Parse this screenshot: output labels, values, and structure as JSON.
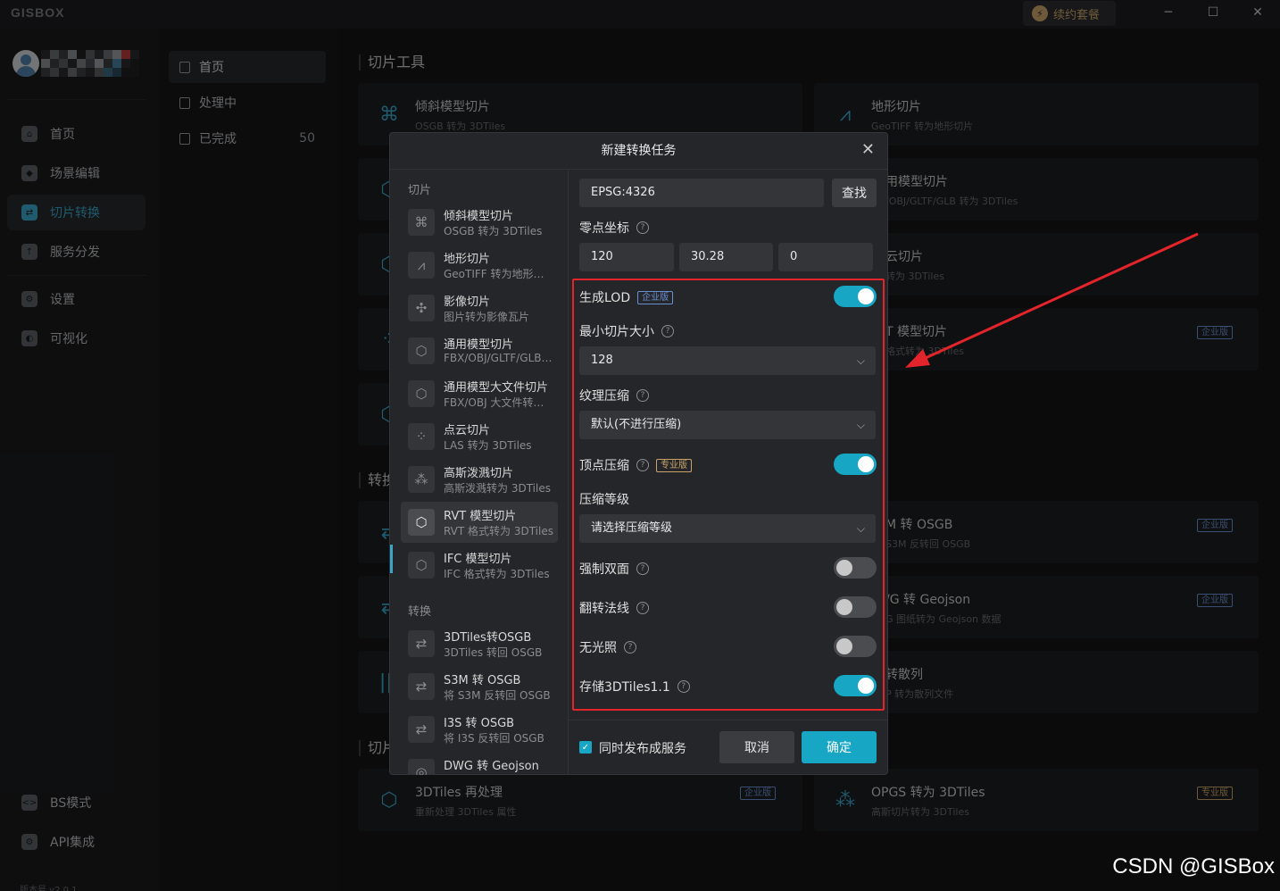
{
  "app": {
    "logo": "GISBOX",
    "renew_label": "续约套餐",
    "renew_icon": "lightning-icon",
    "win_min": "─",
    "win_max": "☐",
    "win_close": "✕"
  },
  "sidebar": {
    "items": [
      {
        "label": "首页",
        "icon": "home-icon"
      },
      {
        "label": "场景编辑",
        "icon": "cube-icon"
      },
      {
        "label": "切片转换",
        "icon": "convert-icon",
        "active": true
      },
      {
        "label": "服务分发",
        "icon": "upload-icon"
      },
      {
        "label": "设置",
        "icon": "gear-icon"
      },
      {
        "label": "可视化",
        "icon": "visual-icon"
      },
      {
        "label": "BS模式",
        "icon": "code-icon"
      },
      {
        "label": "API集成",
        "icon": "api-icon"
      }
    ],
    "version": "版本号 v2.0.1"
  },
  "subnav": {
    "items": [
      {
        "label": "首页"
      },
      {
        "label": "处理中"
      },
      {
        "label": "已完成",
        "count": "50"
      }
    ]
  },
  "main": {
    "section1": "切片工具",
    "section2": "转换",
    "section3": "切片",
    "cards_left": [
      {
        "title": "倾斜模型切片",
        "sub": "OSGB 转为 3DTiles"
      }
    ],
    "cards_right": [
      {
        "title": "地形切片",
        "sub": "GeoTIFF 转为地形切片"
      },
      {
        "title": "用模型切片",
        "sub": "/OBJ/GLTF/GLB 转为 3DTiles"
      },
      {
        "title": "云切片",
        "sub": "转为 3DTiles"
      },
      {
        "title": "T 模型切片",
        "sub": "格式转为 3DTiles",
        "badge": "企业版"
      },
      {
        "title": "M 转 OSGB",
        "sub": "S3M 反转回 OSGB",
        "badge": "企业版"
      },
      {
        "title": "/G 转 Geojson",
        "sub": "G 图纸转为 Geojson 数据",
        "badge": "企业版"
      },
      {
        "title": "转散列",
        "sub": "P 转为散列文件"
      }
    ],
    "bottom_left": {
      "title": "3DTiles 再处理",
      "sub": "重新处理 3DTiles 属性",
      "badge": "企业版"
    },
    "bottom_right": {
      "title": "OPGS 转为 3DTiles",
      "sub": "高斯切片转为 3DTiles",
      "badge": "专业版"
    }
  },
  "dialog": {
    "title": "新建转换任务",
    "close": "✕",
    "group_slice": "切片",
    "group_convert": "转换",
    "list": [
      {
        "title": "倾斜模型切片",
        "sub": "OSGB 转为 3DTiles",
        "icon": "oblique-icon"
      },
      {
        "title": "地形切片",
        "sub": "GeoTIFF 转为地形…",
        "icon": "terrain-icon"
      },
      {
        "title": "影像切片",
        "sub": "图片转为影像瓦片",
        "icon": "satellite-icon"
      },
      {
        "title": "通用模型切片",
        "sub": "FBX/OBJ/GLTF/GLB…",
        "icon": "box-icon"
      },
      {
        "title": "通用模型大文件切片",
        "sub": "FBX/OBJ 大文件转…",
        "icon": "box-icon"
      },
      {
        "title": "点云切片",
        "sub": "LAS 转为 3DTiles",
        "icon": "pointcloud-icon"
      },
      {
        "title": "高斯泼溅切片",
        "sub": "高斯泼溅转为 3DTiles",
        "icon": "gaussian-icon"
      },
      {
        "title": "RVT 模型切片",
        "sub": "RVT 格式转为 3DTiles",
        "icon": "box-icon",
        "active": true
      },
      {
        "title": "IFC 模型切片",
        "sub": "IFC 格式转为 3DTiles",
        "icon": "box-icon"
      }
    ],
    "list2": [
      {
        "title": "3DTiles转OSGB",
        "sub": "3DTiles 转回 OSGB",
        "icon": "convert-icon"
      },
      {
        "title": "S3M 转 OSGB",
        "sub": "将 S3M 反转回 OSGB",
        "icon": "convert-icon"
      },
      {
        "title": "I3S 转 OSGB",
        "sub": "将 I3S 反转回 OSGB",
        "icon": "convert-icon"
      },
      {
        "title": "DWG 转 Geojson",
        "sub": "",
        "icon": "dwg-icon"
      }
    ],
    "epsg": "EPSG:4326",
    "find_label": "查找",
    "origin_label": "零点坐标",
    "origin": [
      "120",
      "30.28",
      "0"
    ],
    "lod_label": "生成LOD",
    "lod_badge": "企业版",
    "min_tile_label": "最小切片大小",
    "min_tile_value": "128",
    "texture_label": "纹理压缩",
    "texture_value": "默认(不进行压缩)",
    "vertex_label": "顶点压缩",
    "vertex_badge": "专业版",
    "level_label": "压缩等级",
    "level_placeholder": "请选择压缩等级",
    "double_label": "强制双面",
    "flip_label": "翻转法线",
    "nolight_label": "无光照",
    "tiles11_label": "存储3DTiles1.1",
    "toggles": {
      "lod": true,
      "vertex": true,
      "double": false,
      "flip": false,
      "nolight": false,
      "tiles11": true
    },
    "publish_label": "同时发布成服务",
    "cancel_label": "取消",
    "ok_label": "确定"
  },
  "watermark": "CSDN @GISBox",
  "colors": {
    "accent": "#17a6c4",
    "highlight_box": "#e3242b",
    "enterprise": "#6a8fd0",
    "pro": "#c9a46a"
  }
}
